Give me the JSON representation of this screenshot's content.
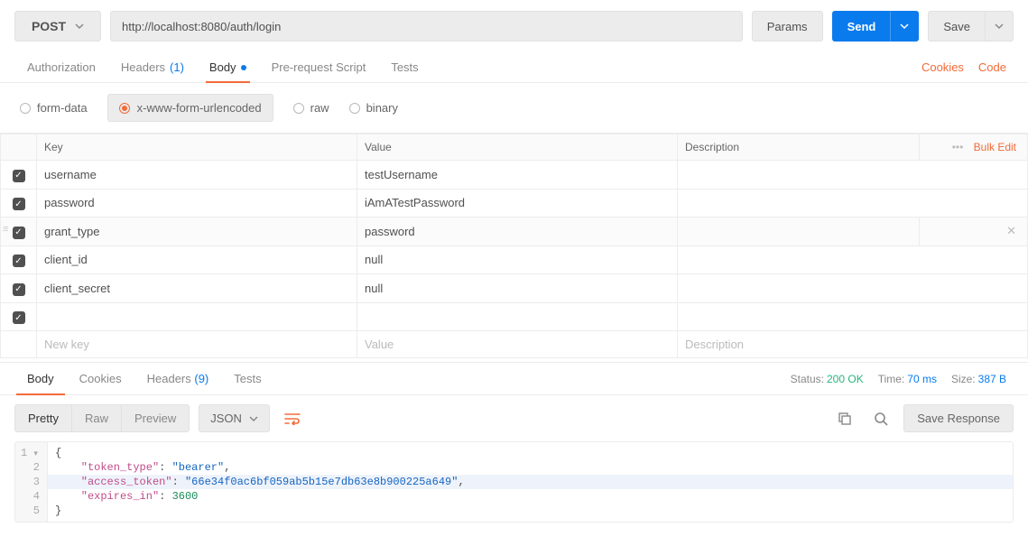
{
  "request": {
    "method": "POST",
    "url": "http://localhost:8080/auth/login",
    "params_btn": "Params",
    "send_btn": "Send",
    "save_btn": "Save"
  },
  "tabs": {
    "authorization": "Authorization",
    "headers": {
      "label": "Headers",
      "count": "(1)"
    },
    "body": "Body",
    "prerequest": "Pre-request Script",
    "tests": "Tests",
    "cookies": "Cookies",
    "code": "Code",
    "active": "body"
  },
  "body_types": {
    "form_data": "form-data",
    "urlencoded": "x-www-form-urlencoded",
    "raw": "raw",
    "binary": "binary",
    "selected": "urlencoded"
  },
  "table": {
    "h_key": "Key",
    "h_value": "Value",
    "h_desc": "Description",
    "bulk": "Bulk Edit",
    "p_key": "New key",
    "p_value": "Value",
    "p_desc": "Description",
    "rows": [
      {
        "key": "username",
        "value": "testUsername",
        "desc": "",
        "checked": true
      },
      {
        "key": "password",
        "value": "iAmATestPassword",
        "desc": "",
        "checked": true
      },
      {
        "key": "grant_type",
        "value": "password",
        "desc": "",
        "checked": true
      },
      {
        "key": "client_id",
        "value": "null",
        "desc": "",
        "checked": true
      },
      {
        "key": "client_secret",
        "value": "null",
        "desc": "",
        "checked": true
      },
      {
        "key": "",
        "value": "",
        "desc": "",
        "checked": true
      }
    ]
  },
  "response": {
    "tabs": {
      "body": "Body",
      "cookies": "Cookies",
      "headers": {
        "label": "Headers",
        "count": "(9)"
      },
      "tests": "Tests"
    },
    "status_label": "Status:",
    "status_value": "200 OK",
    "time_label": "Time:",
    "time_value": "70 ms",
    "size_label": "Size:",
    "size_value": "387 B",
    "view": {
      "pretty": "Pretty",
      "raw": "Raw",
      "preview": "Preview",
      "format": "JSON",
      "save": "Save Response"
    },
    "json": {
      "line1": "{",
      "line2_k": "\"token_type\"",
      "line2_v": "\"bearer\"",
      "line3_k": "\"access_token\"",
      "line3_v": "\"66e34f0ac6bf059ab5b15e7db63e8b900225a649\"",
      "line4_k": "\"expires_in\"",
      "line4_v": "3600",
      "line5": "}"
    }
  }
}
